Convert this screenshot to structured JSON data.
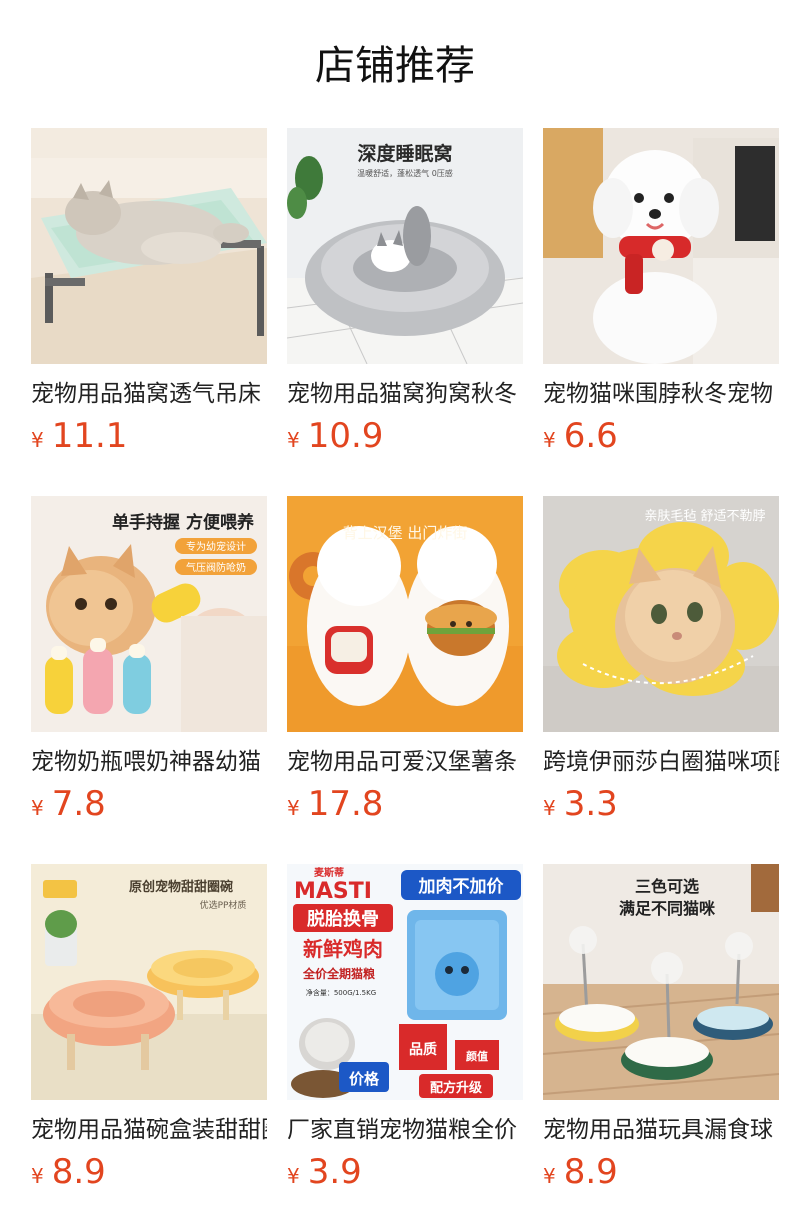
{
  "header": {
    "title": "店铺推荐"
  },
  "currency_symbol": "¥",
  "products": [
    {
      "name": "宠物用品猫窝透气吊床",
      "price": "11.1",
      "image_icon": "cat-hammock-bed-photo",
      "image_text": []
    },
    {
      "name": "宠物用品猫窝狗窝秋冬",
      "price": "10.9",
      "image_icon": "plush-round-bed-photo",
      "image_text": [
        "深度睡眠窝",
        "温暖舒适，蓬松透气 0压感"
      ]
    },
    {
      "name": "宠物猫咪围脖秋冬宠物",
      "price": "6.6",
      "image_icon": "dog-red-scarf-photo",
      "image_text": []
    },
    {
      "name": "宠物奶瓶喂奶神器幼猫",
      "price": "7.8",
      "image_icon": "kitten-feeding-bottle-photo",
      "image_text": [
        "单手持握 方便喂养",
        "专为幼宠设计",
        "气压阀防呛奶"
      ]
    },
    {
      "name": "宠物用品可爱汉堡薯条",
      "price": "17.8",
      "image_icon": "dog-burger-backpack-photo",
      "image_text": [
        "背上汉堡 出门炸街"
      ]
    },
    {
      "name": "跨境伊丽莎白圈猫咪项圈",
      "price": "3.3",
      "image_icon": "cat-flower-cone-photo",
      "image_text": [
        "亲肤毛毡 舒适不勒脖"
      ]
    },
    {
      "name": "宠物用品猫碗盒装甜甜圈",
      "price": "8.9",
      "image_icon": "ceramic-pet-bowls-photo",
      "image_text": [
        "原创宠物甜甜圈碗",
        "优选PP材质"
      ]
    },
    {
      "name": "厂家直销宠物猫粮全价",
      "price": "3.9",
      "image_icon": "cat-food-bag-photo",
      "image_text": [
        "麦斯蒂",
        "MASTI",
        "加肉不加价",
        "脱胎换骨",
        "新鲜鸡肉",
        "全价全期猫粮",
        "净含量：500G/1.5KG",
        "品质",
        "颜值",
        "价格",
        "配方升级"
      ]
    },
    {
      "name": "宠物用品猫玩具漏食球",
      "price": "8.9",
      "image_icon": "treat-dispenser-toy-photo",
      "image_text": [
        "三色可选",
        "满足不同猫咪"
      ]
    }
  ]
}
